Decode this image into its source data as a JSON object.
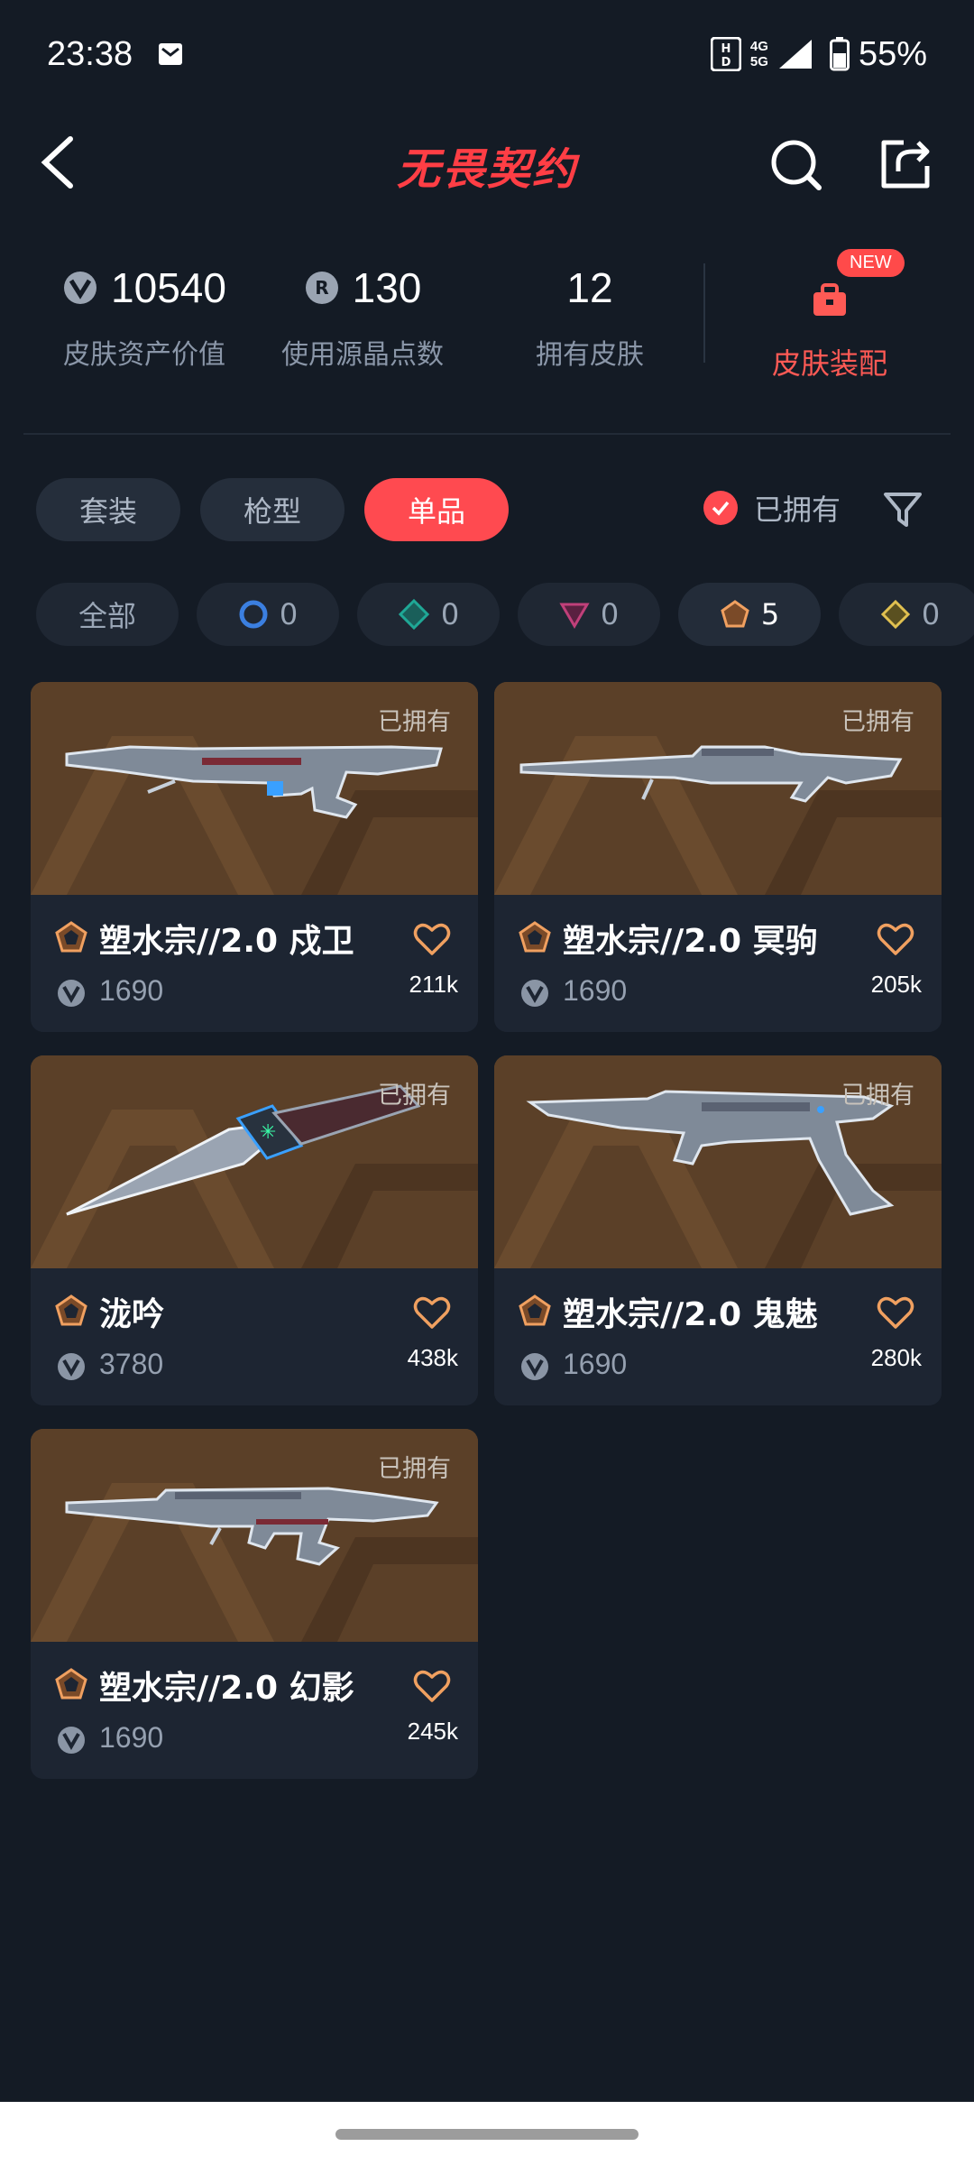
{
  "status_bar": {
    "time": "23:38",
    "network_top": "4G",
    "network_bottom": "5G",
    "battery": "55%"
  },
  "header": {
    "title": "无畏契约"
  },
  "stats": [
    {
      "value": "10540",
      "label": "皮肤资产价值",
      "icon": "vp-coin-icon"
    },
    {
      "value": "130",
      "label": "使用源晶点数",
      "icon": "radianite-icon"
    },
    {
      "value": "12",
      "label": "拥有皮肤",
      "icon": ""
    }
  ],
  "outfit": {
    "badge": "NEW",
    "label": "皮肤装配",
    "icon": "briefcase-icon",
    "color": "#ff5a55"
  },
  "tabs": [
    {
      "label": "套装",
      "active": false
    },
    {
      "label": "枪型",
      "active": false
    },
    {
      "label": "单品",
      "active": true
    }
  ],
  "owned_filter": {
    "label": "已拥有",
    "checked": true
  },
  "rarity_chips": [
    {
      "label": "全部",
      "count": ""
    },
    {
      "icon": "select-tier-icon",
      "count": "0",
      "color": "#3b7fe0"
    },
    {
      "icon": "deluxe-tier-icon",
      "count": "0",
      "color": "#1fa896"
    },
    {
      "icon": "premium-tier-icon",
      "count": "0",
      "color": "#c0407a"
    },
    {
      "icon": "exclusive-tier-icon",
      "count": "5",
      "color": "#f0a060"
    },
    {
      "icon": "ultra-tier-icon",
      "count": "0",
      "color": "#e0c050"
    }
  ],
  "skins": [
    {
      "name": "塑水宗//2.0 戍卫",
      "price": "1690",
      "likes": "211k",
      "owned": "已拥有",
      "weapon": "vandal"
    },
    {
      "name": "塑水宗//2.0 冥驹",
      "price": "1690",
      "likes": "205k",
      "owned": "已拥有",
      "weapon": "operator"
    },
    {
      "name": "泷吟",
      "price": "3780",
      "likes": "438k",
      "owned": "已拥有",
      "weapon": "knife"
    },
    {
      "name": "塑水宗//2.0 鬼魅",
      "price": "1690",
      "likes": "280k",
      "owned": "已拥有",
      "weapon": "ghost"
    },
    {
      "name": "塑水宗//2.0 幻影",
      "price": "1690",
      "likes": "245k",
      "owned": "已拥有",
      "weapon": "phantom"
    }
  ],
  "colors": {
    "accent": "#ff4a50",
    "background": "#141b25",
    "card": "#1d2532",
    "tier_exclusive": "#f0a060"
  }
}
